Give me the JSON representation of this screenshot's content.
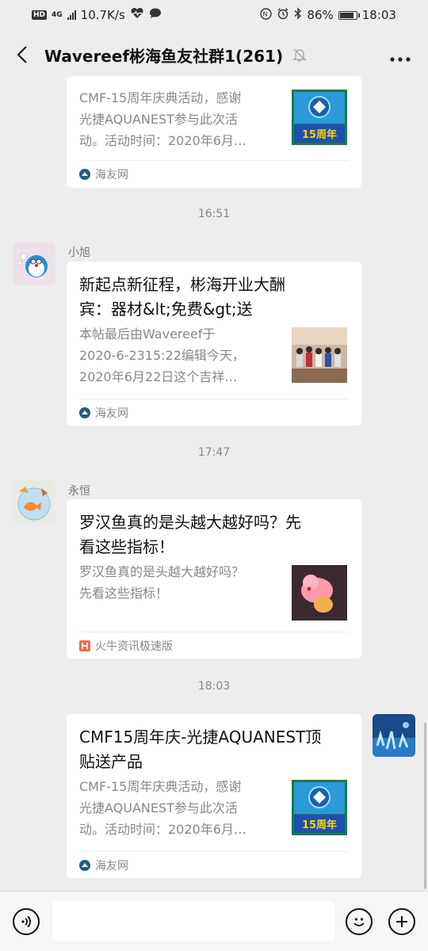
{
  "status_bar": {
    "hd": "HD",
    "network": "4G",
    "speed": "10.7K/s",
    "battery": "86%",
    "battery_level": 0.86,
    "time": "18:03"
  },
  "header": {
    "title": "Wavereef彬海鱼友社群1(261)",
    "back_icon": "chevron-left-icon",
    "mute_icon": "bell-off-icon",
    "more_icon": "more-icon"
  },
  "messages": [
    {
      "type": "card",
      "desc": "CMF-15周年庆典活动，感谢光捷AQUANEST参与此次活动。活动时间：2020年6月…",
      "desc_lines": [
        "CMF-15周年庆典活动，感谢",
        "光捷AQUANEST参与此次活",
        "动。活动时间：2020年6月…"
      ],
      "thumb_text": "15周年",
      "source": "海友网"
    },
    {
      "timestamp": "16:51",
      "sender": "小旭",
      "title_lines": [
        "新起点新征程，彬海开业大酬",
        "宾：器材&lt;免费&gt;送"
      ],
      "desc_lines": [
        "本帖最后由Wavereef于",
        "2020-6-2315:22编辑今天，",
        "2020年6月22日这个吉祥…"
      ],
      "source": "海友网"
    },
    {
      "timestamp": "17:47",
      "sender": "永恒",
      "title_lines": [
        "罗汉鱼真的是头越大越好吗？先",
        "看这些指标！"
      ],
      "desc_lines": [
        "罗汉鱼真的是头越大越好吗？",
        "先看这些指标！"
      ],
      "source": "火牛资讯极速版"
    },
    {
      "timestamp": "18:03",
      "title_lines": [
        "CMF15周年庆-光捷AQUANEST顶",
        "贴送产品"
      ],
      "desc_lines": [
        "CMF-15周年庆典活动，感谢",
        "光捷AQUANEST参与此次活",
        "动。活动时间：2020年6月…"
      ],
      "thumb_text": "15周年",
      "source": "海友网"
    }
  ],
  "input_bar": {
    "voice_icon": "voice-icon",
    "emoji_icon": "emoji-icon",
    "add_icon": "plus-icon",
    "placeholder": ""
  },
  "colors": {
    "background": "#ededed",
    "card": "#ffffff",
    "muted_text": "#888888"
  }
}
